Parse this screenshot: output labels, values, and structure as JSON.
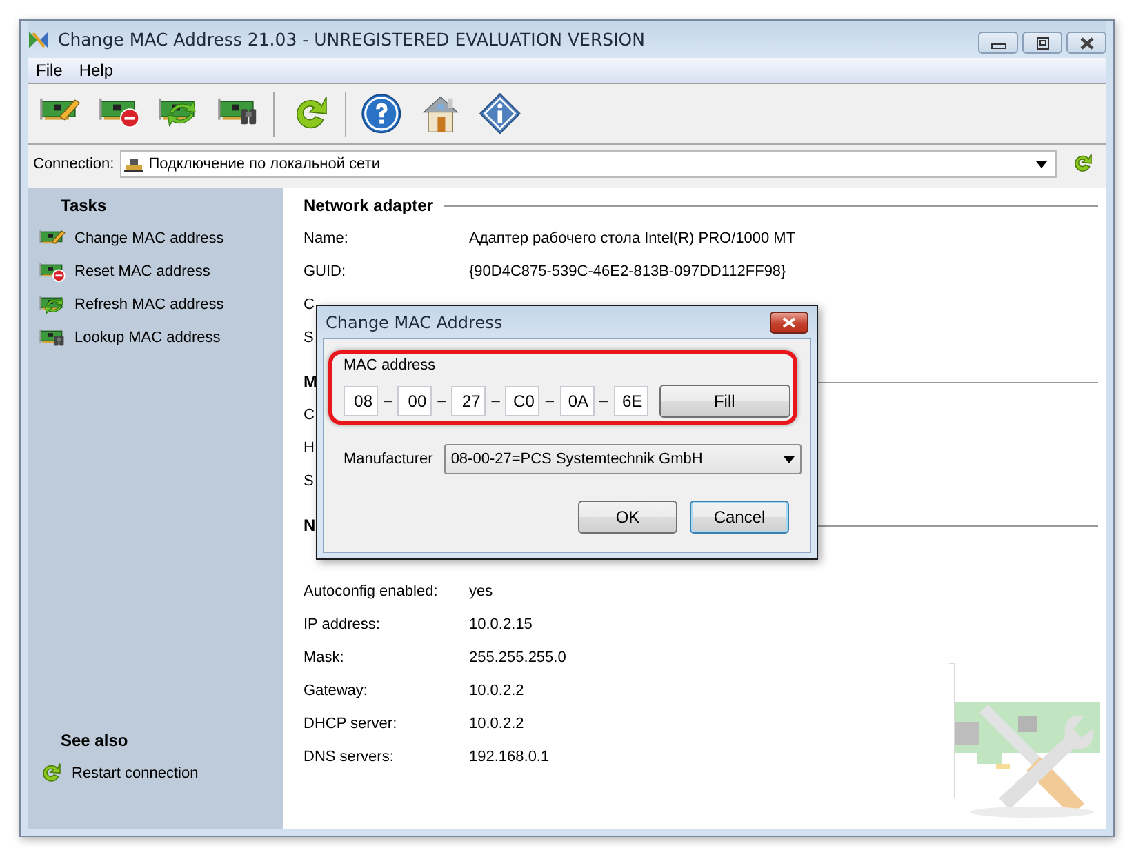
{
  "window": {
    "title": "Change MAC Address 21.03 - UNREGISTERED EVALUATION VERSION"
  },
  "menu": [
    "File",
    "Help"
  ],
  "connection": {
    "label": "Connection:",
    "value": "Подключение по локальной сети"
  },
  "sidebar": {
    "tasks_title": "Tasks",
    "tasks": [
      "Change MAC address",
      "Reset MAC address",
      "Refresh MAC address",
      "Lookup MAC address"
    ],
    "see_also_title": "See also",
    "see_also": [
      "Restart connection"
    ]
  },
  "details": {
    "sections": [
      {
        "title": "Network adapter",
        "rows": [
          {
            "label": "Name:",
            "value": "Адаптер рабочего стола Intel(R) PRO/1000 MT"
          },
          {
            "label": "GUID:",
            "value": "{90D4C875-539C-46E2-813B-097DD112FF98}"
          },
          {
            "label": "C"
          },
          {
            "label": "S"
          }
        ]
      },
      {
        "title": "M",
        "rows": [
          {
            "label": "C"
          },
          {
            "label": "H"
          },
          {
            "label": "S"
          }
        ]
      },
      {
        "title": "N",
        "rows": [
          {
            "label": "Autoconfig enabled:",
            "value": "yes"
          },
          {
            "label": "IP address:",
            "value": "10.0.2.15"
          },
          {
            "label": "Mask:",
            "value": "255.255.255.0"
          },
          {
            "label": "Gateway:",
            "value": "10.0.2.2"
          },
          {
            "label": "DHCP server:",
            "value": "10.0.2.2"
          },
          {
            "label": "DNS servers:",
            "value": "192.168.0.1"
          }
        ]
      }
    ]
  },
  "dialog": {
    "title": "Change MAC Address",
    "group_label": "MAC address",
    "octets": [
      "08",
      "00",
      "27",
      "C0",
      "0A",
      "6E"
    ],
    "separator": "–",
    "fill_button": "Fill",
    "manufacturer_label": "Manufacturer",
    "manufacturer": "08-00-27=PCS Systemtechnik GmbH",
    "buttons": [
      {
        "label": "OK",
        "focused": false
      },
      {
        "label": "Cancel",
        "focused": true
      }
    ]
  }
}
